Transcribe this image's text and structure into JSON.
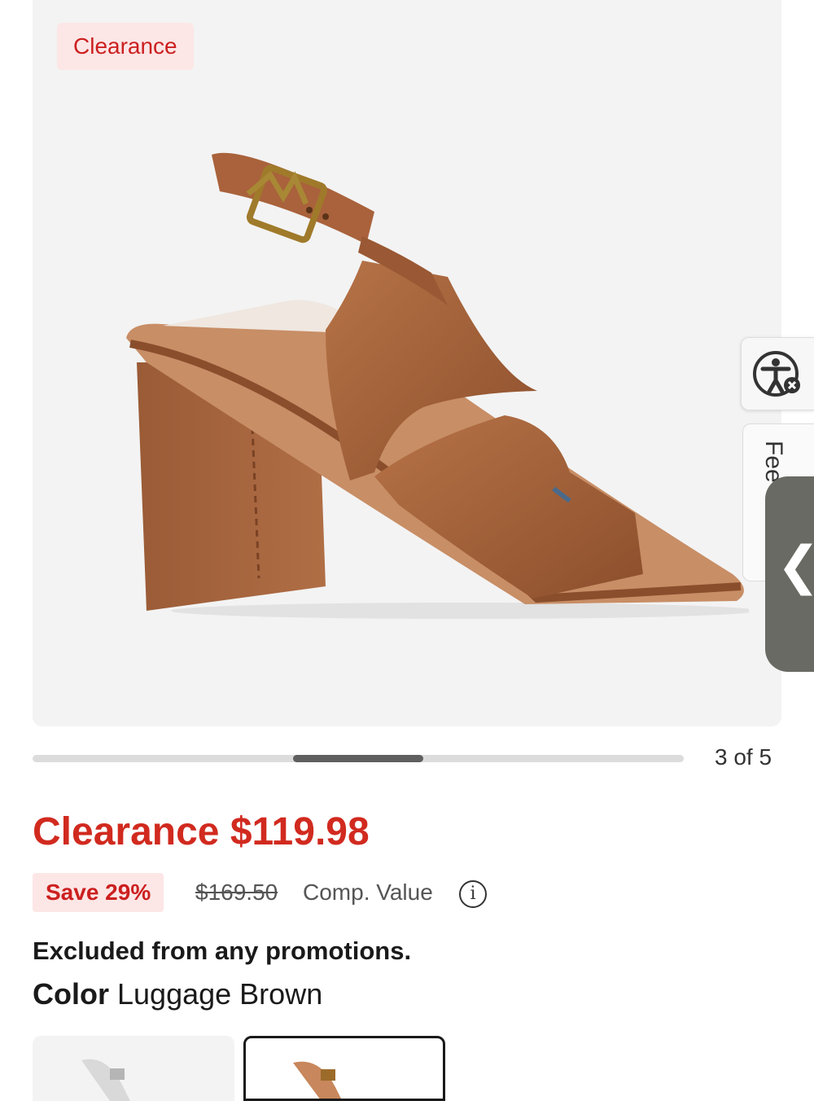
{
  "gallery": {
    "badge": "Clearance",
    "counter": "3 of 5",
    "progress": {
      "start": 0.4,
      "end": 0.6
    }
  },
  "side": {
    "feedback_label": "Fee",
    "chevron": "❮"
  },
  "price": {
    "label": "Clearance $119.98",
    "save": "Save 29%",
    "was": "$169.50",
    "comp_label": "Comp. Value"
  },
  "promo_note": "Excluded from any promotions.",
  "color": {
    "label": "Color",
    "value": "Luggage Brown"
  },
  "colors": {
    "accent": "#d12a1f",
    "badge_bg": "#fde6e6",
    "shoe": "#a8643a"
  },
  "icons": [
    "accessibility-icon",
    "info-icon",
    "chevron-left-icon",
    "sandal-product-image"
  ]
}
